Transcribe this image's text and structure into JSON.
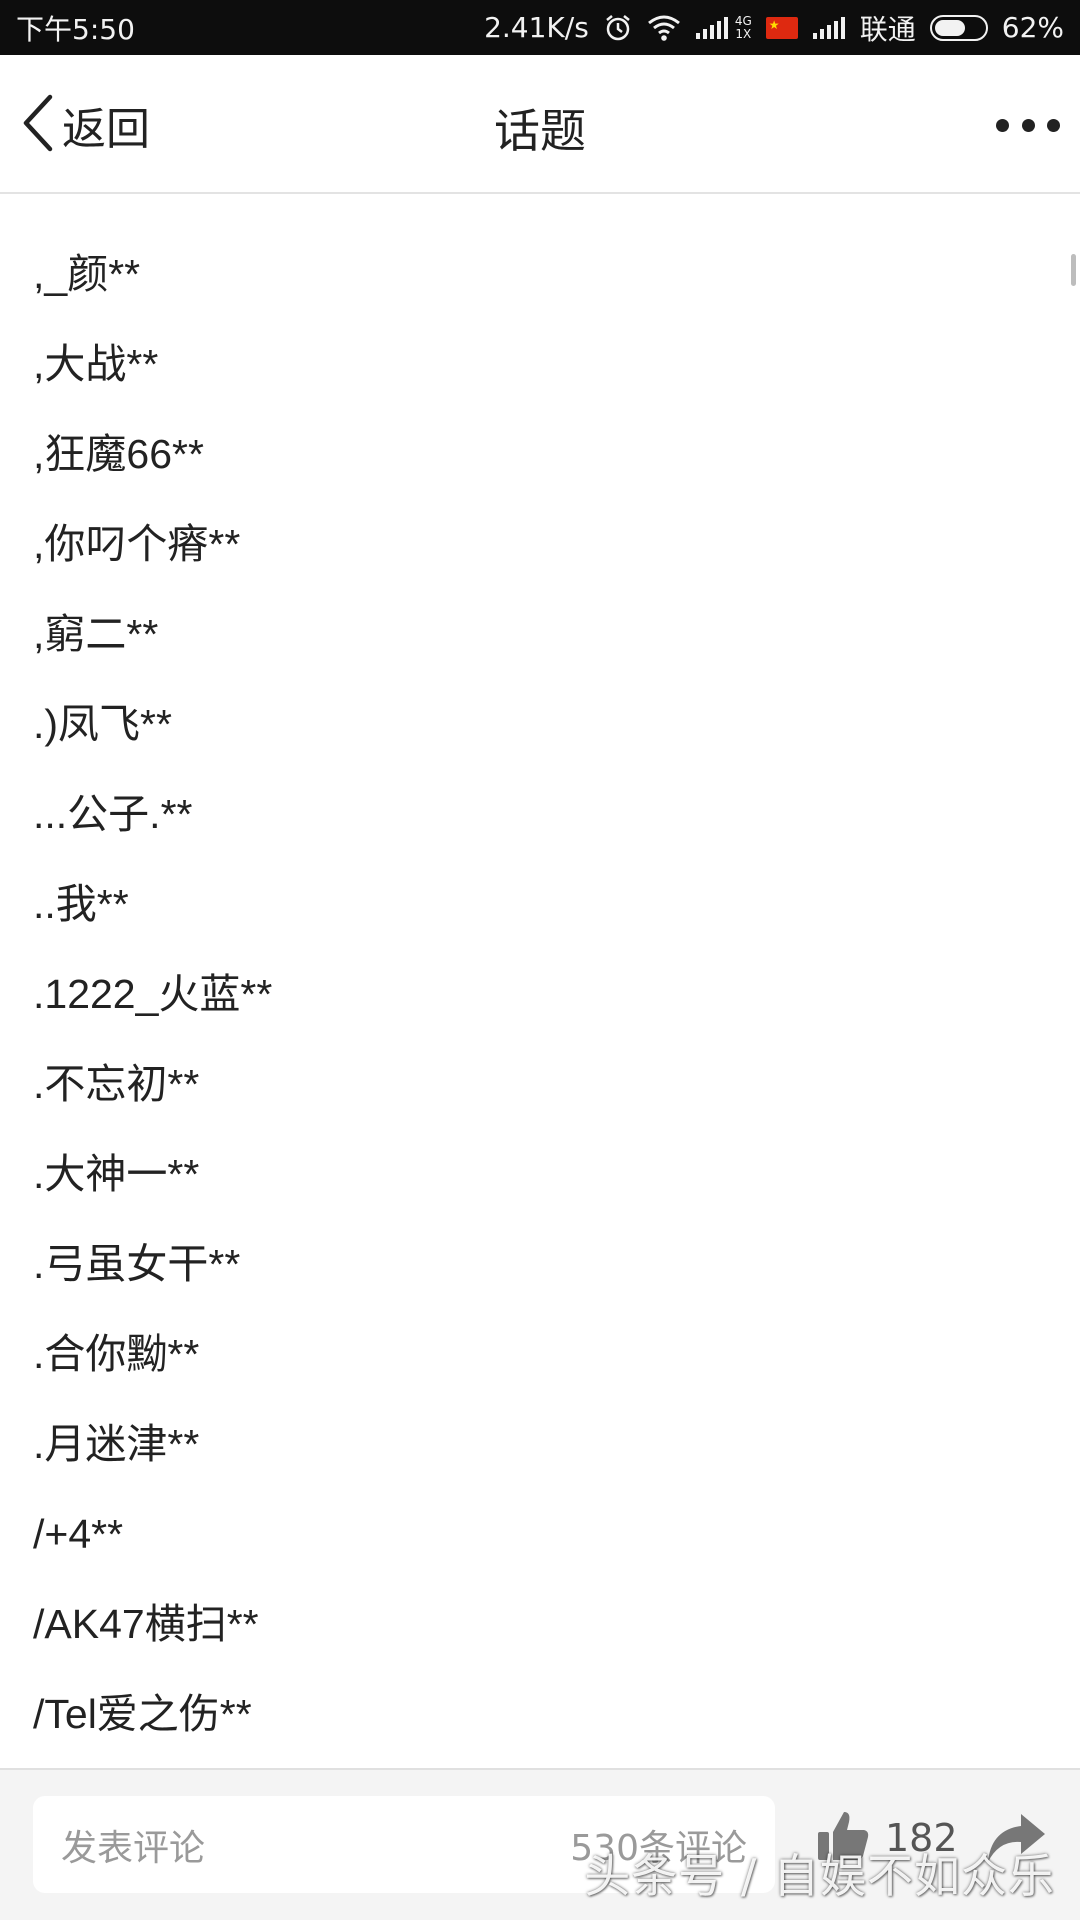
{
  "status_bar": {
    "time": "下午5:50",
    "speed": "2.41K/s",
    "network_label_top": "4G",
    "network_label_bottom": "1X",
    "carrier": "联通",
    "battery": "62%",
    "battery_level": 0.62
  },
  "navbar": {
    "back_label": "返回",
    "title": "话题"
  },
  "list": {
    "items": [
      ",_颜**",
      ",大战**",
      ",狂魔66**",
      ",你叼个瘠**",
      ",窮二**",
      ".)凤飞**",
      "...公子.**",
      "..我**",
      ".1222_火蓝**",
      ".不忘初**",
      ".大神一**",
      ".弓虽女干**",
      ".合你黝**",
      ".月迷津**",
      "/+4**",
      "/AK47横扫**",
      "/Tel爱之伤**"
    ]
  },
  "bottom_bar": {
    "comment_placeholder": "发表评论",
    "comment_count": "530条评论",
    "like_count": "182"
  },
  "watermark": "头条号 / 自娱不如众乐",
  "icons": {
    "back": "chevron-left-icon",
    "more": "more-dots-icon",
    "like": "thumbs-up-icon",
    "share": "share-arrow-icon",
    "alarm": "alarm-icon",
    "wifi": "wifi-icon",
    "signal": "signal-icon",
    "flag": "flag-icon",
    "battery": "battery-icon"
  }
}
